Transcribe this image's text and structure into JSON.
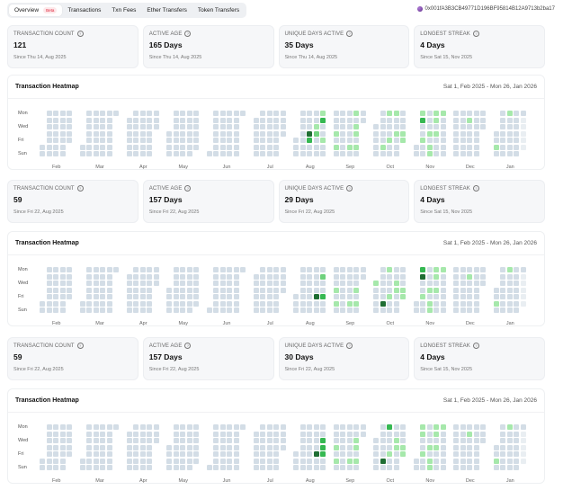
{
  "tabs": [
    {
      "label": "Overview",
      "badge": "Beta",
      "active": true
    },
    {
      "label": "Transactions"
    },
    {
      "label": "Txn Fees"
    },
    {
      "label": "Ether Transfers"
    },
    {
      "label": "Token Transfers"
    }
  ],
  "address": "0x001fA3B3CB49771D196BF95814B12A9713b2ba17",
  "colors": {
    "empty": "#d3dde6",
    "future": "#e9eef2",
    "levels": [
      "#a6e8ab",
      "#6fd17d",
      "#36b852",
      "#1f6e33"
    ]
  },
  "heatmap_common": {
    "day_labels": [
      "Mon",
      "",
      "Wed",
      "",
      "Fri",
      "",
      "Sun"
    ],
    "months": [
      {
        "label": "Feb",
        "year": 2025,
        "month": 2
      },
      {
        "label": "Mar",
        "year": 2025,
        "month": 3
      },
      {
        "label": "Apr",
        "year": 2025,
        "month": 4
      },
      {
        "label": "May",
        "year": 2025,
        "month": 5
      },
      {
        "label": "Jun",
        "year": 2025,
        "month": 6
      },
      {
        "label": "Jul",
        "year": 2025,
        "month": 7
      },
      {
        "label": "Aug",
        "year": 2025,
        "month": 8
      },
      {
        "label": "Sep",
        "year": 2025,
        "month": 9
      },
      {
        "label": "Oct",
        "year": 2025,
        "month": 10
      },
      {
        "label": "Nov",
        "year": 2025,
        "month": 11
      },
      {
        "label": "Dec",
        "year": 2025,
        "month": 12
      },
      {
        "label": "Jan",
        "year": 2026,
        "month": 1
      }
    ],
    "last_date": "2026-01-26"
  },
  "sections": [
    {
      "stats": [
        {
          "label": "TRANSACTION COUNT",
          "value": "121",
          "since": "Since Thu 14, Aug 2025"
        },
        {
          "label": "ACTIVE AGE",
          "value": "165 Days",
          "since": "Since Thu 14, Aug 2025"
        },
        {
          "label": "UNIQUE DAYS ACTIVE",
          "value": "35 Days",
          "since": "Since Thu 14, Aug 2025"
        },
        {
          "label": "LONGEST STREAK",
          "value": "4 Days",
          "since": "Since Sat 15, Nov 2025"
        }
      ],
      "heatmap": {
        "title": "Transaction Heatmap",
        "range": "Sat 1, Feb 2025 - Mon 26, Jan 2026",
        "activity": {
          "2025-08-14": 4,
          "2025-08-15": 3,
          "2025-08-20": 1,
          "2025-08-21": 2,
          "2025-08-25": 1,
          "2025-08-26": 3,
          "2025-08-29": 1,
          "2025-09-04": 1,
          "2025-09-06": 1,
          "2025-09-20": 1,
          "2025-09-22": 1,
          "2025-09-24": 1,
          "2025-09-25": 1,
          "2025-09-27": 1,
          "2025-10-11": 1,
          "2025-10-13": 1,
          "2025-10-17": 1,
          "2025-10-20": 1,
          "2025-10-23": 1,
          "2025-10-30": 1,
          "2025-10-31": 1,
          "2025-11-03": 1,
          "2025-11-04": 3,
          "2025-11-07": 1,
          "2025-11-13": 1,
          "2025-11-15": 1,
          "2025-11-16": 1,
          "2025-11-17": 1,
          "2025-11-18": 1,
          "2025-11-20": 1,
          "2025-11-24": 1,
          "2025-12-16": 1,
          "2026-01-03": 1,
          "2026-01-12": 1
        }
      }
    },
    {
      "stats": [
        {
          "label": "TRANSACTION COUNT",
          "value": "59",
          "since": "Since Fri 22, Aug 2025"
        },
        {
          "label": "ACTIVE AGE",
          "value": "157 Days",
          "since": "Since Fri 22, Aug 2025"
        },
        {
          "label": "UNIQUE DAYS ACTIVE",
          "value": "29 Days",
          "since": "Since Fri 22, Aug 2025"
        },
        {
          "label": "LONGEST STREAK",
          "value": "4 Days",
          "since": "Since Sat 15, Nov 2025"
        }
      ],
      "heatmap": {
        "title": "Transaction Heatmap",
        "range": "Sat 1, Feb 2025 - Mon 26, Jan 2026",
        "activity": {
          "2025-08-22": 4,
          "2025-08-26": 2,
          "2025-08-29": 3,
          "2025-09-04": 1,
          "2025-09-06": 1,
          "2025-09-20": 1,
          "2025-09-25": 1,
          "2025-09-27": 1,
          "2025-10-01": 1,
          "2025-10-11": 4,
          "2025-10-13": 1,
          "2025-10-17": 1,
          "2025-10-22": 1,
          "2025-10-23": 1,
          "2025-10-30": 1,
          "2025-10-31": 1,
          "2025-11-03": 3,
          "2025-11-04": 4,
          "2025-11-07": 1,
          "2025-11-13": 1,
          "2025-11-15": 1,
          "2025-11-16": 1,
          "2025-11-17": 1,
          "2025-11-18": 1,
          "2025-11-20": 1,
          "2025-11-24": 1,
          "2025-12-16": 1,
          "2026-01-03": 1,
          "2026-01-12": 1
        }
      }
    },
    {
      "stats": [
        {
          "label": "TRANSACTION COUNT",
          "value": "59",
          "since": "Since Fri 22, Aug 2025"
        },
        {
          "label": "ACTIVE AGE",
          "value": "157 Days",
          "since": "Since Fri 22, Aug 2025"
        },
        {
          "label": "UNIQUE DAYS ACTIVE",
          "value": "30 Days",
          "since": "Since Fri 22, Aug 2025"
        },
        {
          "label": "LONGEST STREAK",
          "value": "4 Days",
          "since": "Since Sat 15, Nov 2025"
        }
      ],
      "heatmap": {
        "title": "Transaction Heatmap",
        "range": "Sat 1, Feb 2025 - Mon 26, Jan 2026",
        "activity": {
          "2025-08-22": 4,
          "2025-08-27": 3,
          "2025-08-28": 3,
          "2025-08-29": 3,
          "2025-09-04": 1,
          "2025-09-06": 1,
          "2025-09-20": 1,
          "2025-09-24": 1,
          "2025-09-25": 1,
          "2025-09-27": 1,
          "2025-10-11": 4,
          "2025-10-13": 3,
          "2025-10-17": 1,
          "2025-10-22": 1,
          "2025-10-23": 1,
          "2025-10-30": 1,
          "2025-10-31": 1,
          "2025-11-03": 1,
          "2025-11-04": 1,
          "2025-11-07": 1,
          "2025-11-13": 1,
          "2025-11-15": 1,
          "2025-11-16": 1,
          "2025-11-17": 1,
          "2025-11-18": 1,
          "2025-11-20": 1,
          "2025-11-24": 1,
          "2025-12-16": 1,
          "2026-01-03": 1,
          "2026-01-12": 1
        }
      }
    }
  ]
}
